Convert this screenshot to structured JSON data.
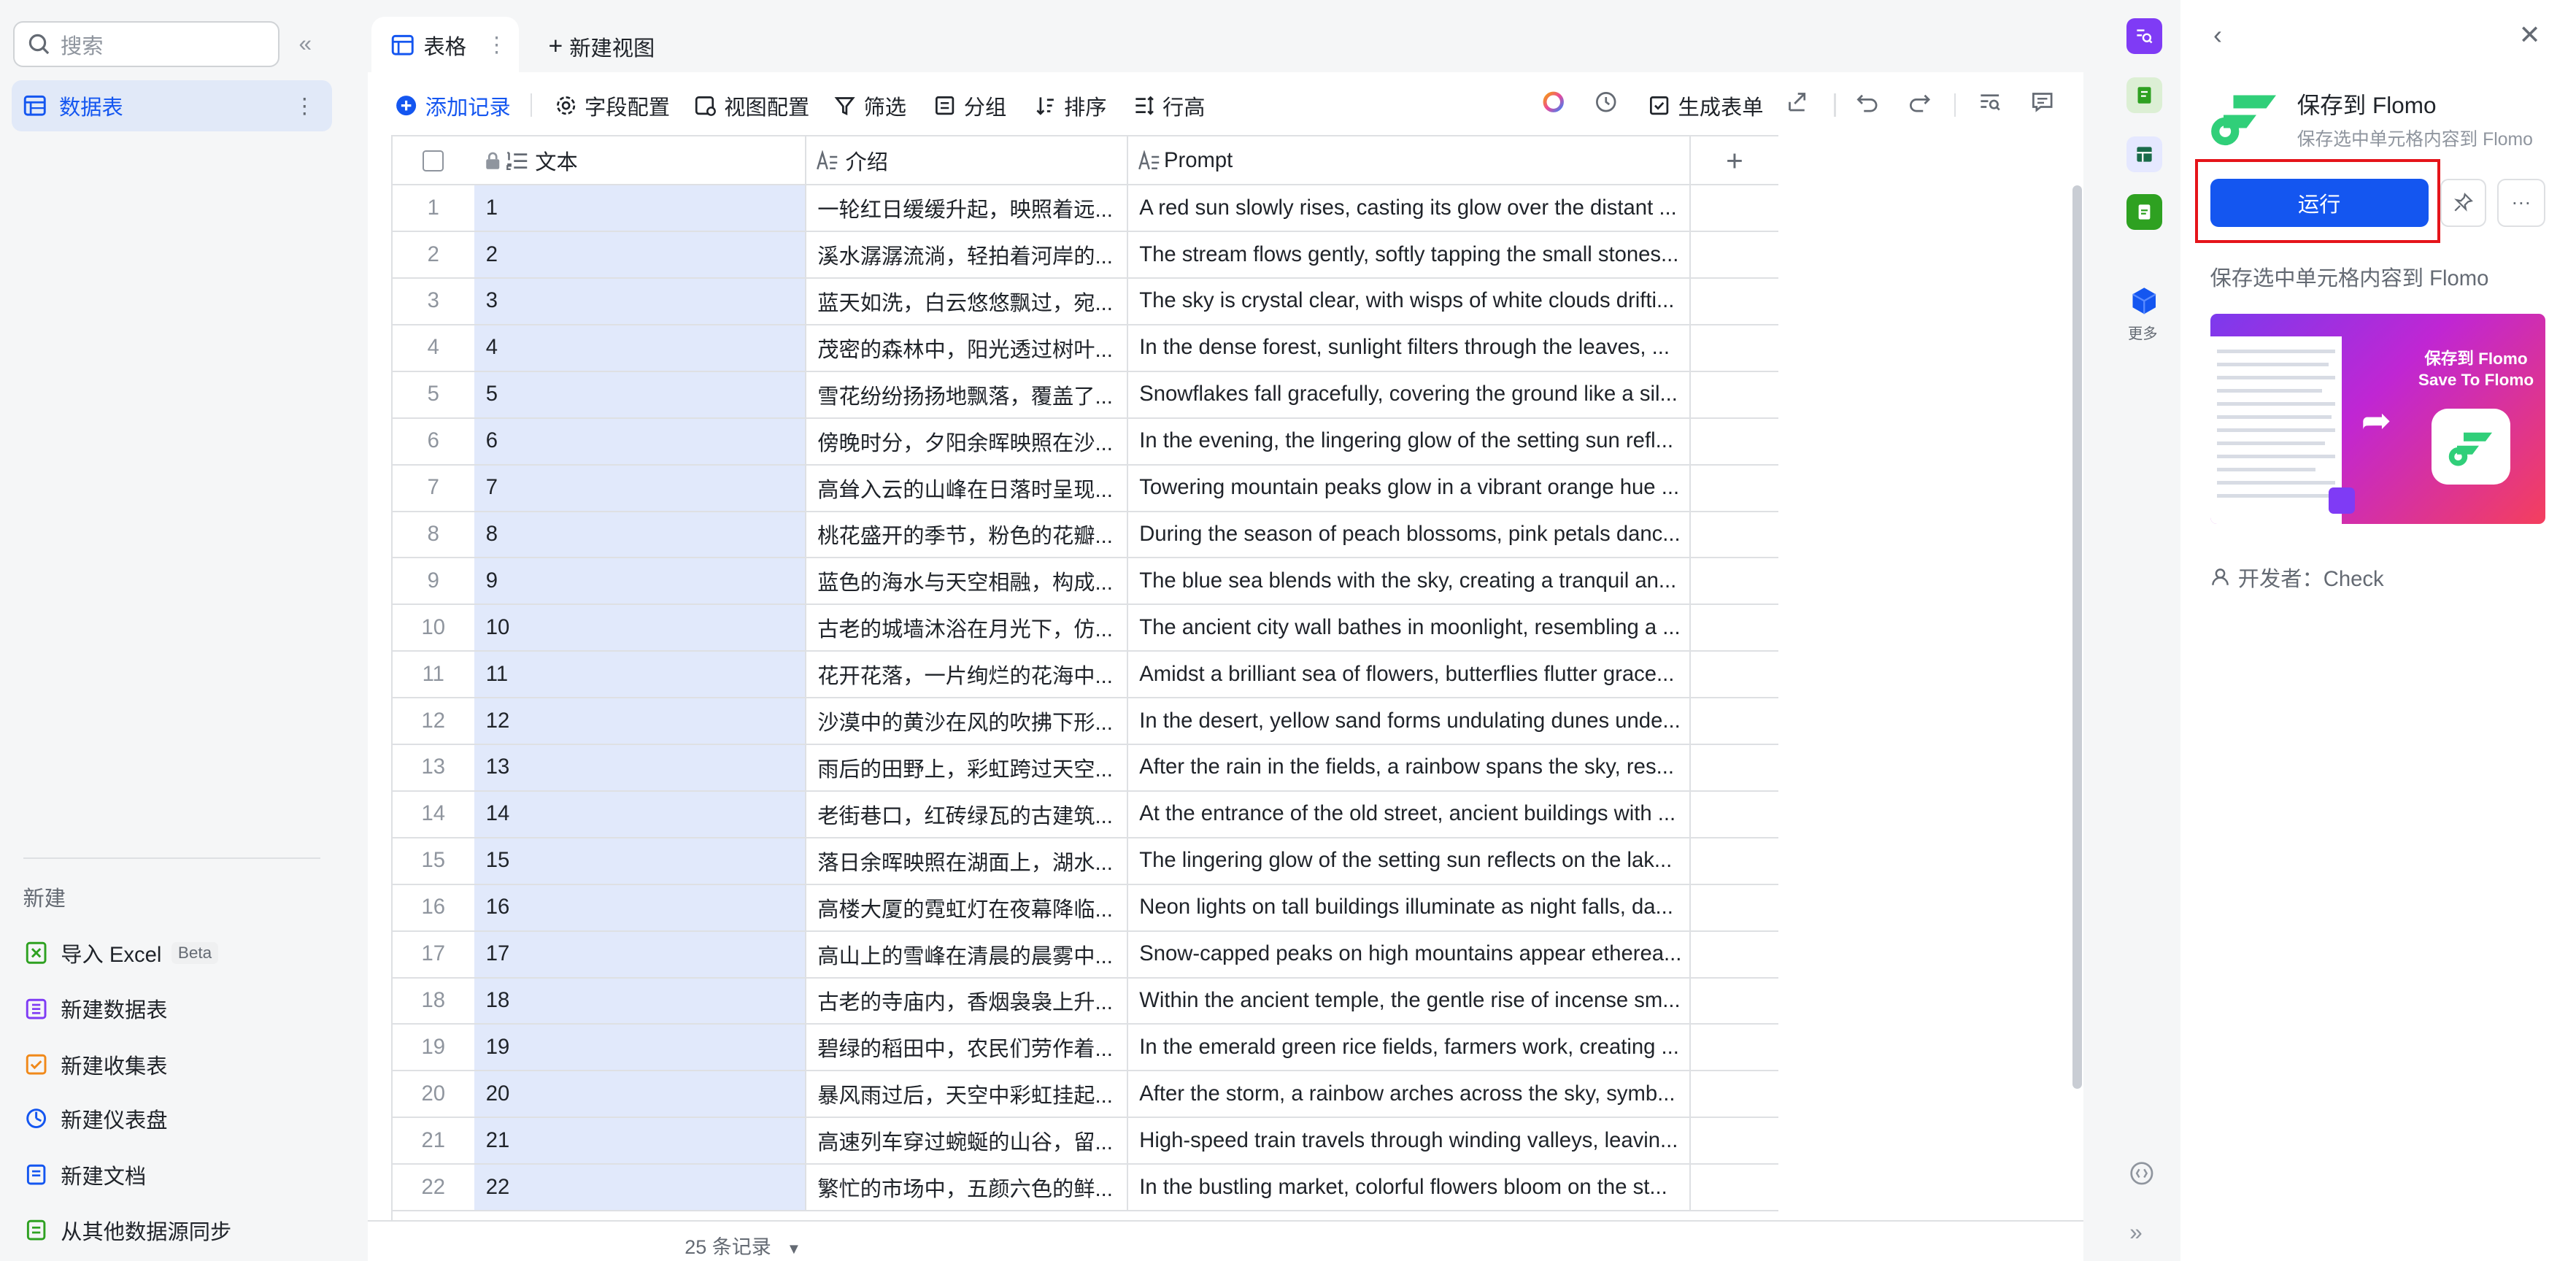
{
  "sidebar": {
    "search_placeholder": "搜索",
    "items": [
      {
        "label": "数据表"
      }
    ],
    "new_section_title": "新建",
    "new_items": [
      {
        "label": "导入 Excel",
        "badge": "Beta"
      },
      {
        "label": "新建数据表"
      },
      {
        "label": "新建收集表"
      },
      {
        "label": "新建仪表盘"
      },
      {
        "label": "新建文档"
      },
      {
        "label": "从其他数据源同步"
      }
    ]
  },
  "tabs": {
    "active_label": "表格",
    "new_view_label": "新建视图"
  },
  "toolbar": {
    "add_record": "添加记录",
    "field_config": "字段配置",
    "view_config": "视图配置",
    "filter": "筛选",
    "group": "分组",
    "sort": "排序",
    "row_height": "行高",
    "generate_form": "生成表单"
  },
  "table": {
    "columns": [
      "文本",
      "介绍",
      "Prompt"
    ],
    "rows": [
      {
        "num": "1",
        "text": "1",
        "intro": "一轮红日缓缓升起，映照着远...",
        "prompt": "A red sun slowly rises, casting its glow over the distant ..."
      },
      {
        "num": "2",
        "text": "2",
        "intro": "溪水潺潺流淌，轻拍着河岸的...",
        "prompt": "The stream flows gently, softly tapping the small stones..."
      },
      {
        "num": "3",
        "text": "3",
        "intro": "蓝天如洗，白云悠悠飘过，宛...",
        "prompt": "The sky is crystal clear, with wisps of white clouds drifti..."
      },
      {
        "num": "4",
        "text": "4",
        "intro": "茂密的森林中，阳光透过树叶...",
        "prompt": "In the dense forest, sunlight filters through the leaves, ..."
      },
      {
        "num": "5",
        "text": "5",
        "intro": "雪花纷纷扬扬地飘落，覆盖了...",
        "prompt": "Snowflakes fall gracefully, covering the ground like a sil..."
      },
      {
        "num": "6",
        "text": "6",
        "intro": "傍晚时分，夕阳余晖映照在沙...",
        "prompt": "In the evening, the lingering glow of the setting sun refl..."
      },
      {
        "num": "7",
        "text": "7",
        "intro": "高耸入云的山峰在日落时呈现...",
        "prompt": "Towering mountain peaks glow in a vibrant orange hue ..."
      },
      {
        "num": "8",
        "text": "8",
        "intro": "桃花盛开的季节，粉色的花瓣...",
        "prompt": "During the season of peach blossoms, pink petals danc..."
      },
      {
        "num": "9",
        "text": "9",
        "intro": "蓝色的海水与天空相融，构成...",
        "prompt": "The blue sea blends with the sky, creating a tranquil an..."
      },
      {
        "num": "10",
        "text": "10",
        "intro": "古老的城墙沐浴在月光下，仿...",
        "prompt": "The ancient city wall bathes in moonlight, resembling a ..."
      },
      {
        "num": "11",
        "text": "11",
        "intro": "花开花落，一片绚烂的花海中...",
        "prompt": "Amidst a brilliant sea of flowers, butterflies flutter grace..."
      },
      {
        "num": "12",
        "text": "12",
        "intro": "沙漠中的黄沙在风的吹拂下形...",
        "prompt": "In the desert, yellow sand forms undulating dunes unde..."
      },
      {
        "num": "13",
        "text": "13",
        "intro": "雨后的田野上，彩虹跨过天空...",
        "prompt": "After the rain in the fields, a rainbow spans the sky, res..."
      },
      {
        "num": "14",
        "text": "14",
        "intro": "老街巷口，红砖绿瓦的古建筑...",
        "prompt": "At the entrance of the old street, ancient buildings with ..."
      },
      {
        "num": "15",
        "text": "15",
        "intro": "落日余晖映照在湖面上，湖水...",
        "prompt": "The lingering glow of the setting sun reflects on the lak..."
      },
      {
        "num": "16",
        "text": "16",
        "intro": "高楼大厦的霓虹灯在夜幕降临...",
        "prompt": "Neon lights on tall buildings illuminate as night falls, da..."
      },
      {
        "num": "17",
        "text": "17",
        "intro": "高山上的雪峰在清晨的晨雾中...",
        "prompt": "Snow-capped peaks on high mountains appear etherea..."
      },
      {
        "num": "18",
        "text": "18",
        "intro": "古老的寺庙内，香烟袅袅上升...",
        "prompt": "Within the ancient temple, the gentle rise of incense sm..."
      },
      {
        "num": "19",
        "text": "19",
        "intro": "碧绿的稻田中，农民们劳作着...",
        "prompt": "In the emerald green rice fields, farmers work, creating ..."
      },
      {
        "num": "20",
        "text": "20",
        "intro": "暴风雨过后，天空中彩虹挂起...",
        "prompt": "After the storm, a rainbow arches across the sky, symb..."
      },
      {
        "num": "21",
        "text": "21",
        "intro": "高速列车穿过蜿蜒的山谷，留...",
        "prompt": "High-speed train travels through winding valleys, leavin..."
      },
      {
        "num": "22",
        "text": "22",
        "intro": "繁忙的市场中，五颜六色的鲜...",
        "prompt": "In the bustling market, colorful flowers bloom on the st..."
      }
    ],
    "record_count": "25 条记录"
  },
  "rail": {
    "more_label": "更多"
  },
  "panel": {
    "title": "保存到 Flomo",
    "subtitle": "保存选中单元格内容到 Flomo",
    "run_label": "运行",
    "description": "保存选中单元格内容到 Flomo",
    "preview_title_cn": "保存到 Flomo",
    "preview_title_en": "Save To Flomo",
    "developer": "开发者：Check"
  },
  "colors": {
    "accent": "#1456f0",
    "highlight_border": "#e5141a",
    "selected_column": "#e1e9fb",
    "flomo_green": "#30cf79"
  }
}
